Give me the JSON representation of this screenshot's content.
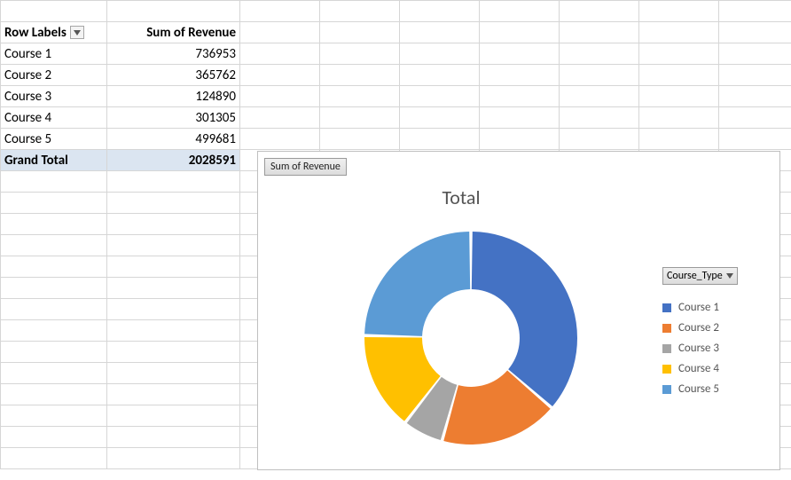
{
  "pivot": {
    "header_rowlabels": "Row Labels",
    "header_value": "Sum of Revenue",
    "rows": [
      {
        "label": "Course 1",
        "value": "736953"
      },
      {
        "label": "Course 2",
        "value": "365762"
      },
      {
        "label": "Course 3",
        "value": "124890"
      },
      {
        "label": "Course 4",
        "value": "301305"
      },
      {
        "label": "Course 5",
        "value": "499681"
      }
    ],
    "grand_label": "Grand Total",
    "grand_value": "2028591"
  },
  "chart": {
    "field_button": "Sum of Revenue",
    "title": "Total",
    "legend_filter_label": "Course_Type",
    "colors": {
      "c1": "#4472c4",
      "c2": "#ed7d31",
      "c3": "#a5a5a5",
      "c4": "#ffc000",
      "c5": "#5b9bd5"
    },
    "legend": [
      {
        "label": "Course 1",
        "color": "#4472c4"
      },
      {
        "label": "Course 2",
        "color": "#ed7d31"
      },
      {
        "label": "Course 3",
        "color": "#a5a5a5"
      },
      {
        "label": "Course 4",
        "color": "#ffc000"
      },
      {
        "label": "Course 5",
        "color": "#5b9bd5"
      }
    ]
  },
  "chart_data": {
    "type": "pie",
    "title": "Total",
    "categories": [
      "Course 1",
      "Course 2",
      "Course 3",
      "Course 4",
      "Course 5"
    ],
    "values": [
      736953,
      365762,
      124890,
      301305,
      499681
    ],
    "series_field": "Course_Type",
    "value_field": "Sum of Revenue",
    "total": 2028591,
    "colors": [
      "#4472c4",
      "#ed7d31",
      "#a5a5a5",
      "#ffc000",
      "#5b9bd5"
    ]
  }
}
